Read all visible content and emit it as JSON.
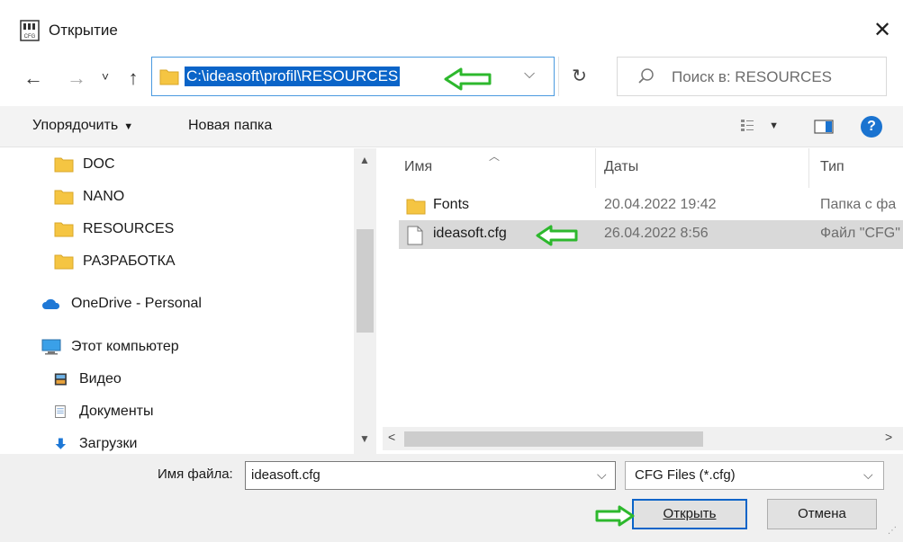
{
  "window": {
    "title": "Открытие",
    "close_label": "✕"
  },
  "nav": {
    "back": "←",
    "forward": "→",
    "recent": "˅",
    "up": "↑",
    "address_path": "C:\\ideasoft\\profil\\RESOURCES",
    "address_dropdown": "⌵",
    "refresh": "↻",
    "search_placeholder": "Поиск в: RESOURCES"
  },
  "toolbar": {
    "organize": "Упорядочить",
    "new_folder": "Новая папка",
    "help": "?"
  },
  "tree": [
    {
      "label": "DOC",
      "icon": "folder-icon"
    },
    {
      "label": "NANO",
      "icon": "folder-icon"
    },
    {
      "label": "RESOURCES",
      "icon": "folder-icon"
    },
    {
      "label": "РАЗРАБОТКА",
      "icon": "folder-icon"
    },
    {
      "label": "OneDrive - Personal",
      "icon": "cloud-icon"
    },
    {
      "label": "Этот компьютер",
      "icon": "computer-icon"
    },
    {
      "label": "Видео",
      "icon": "video-icon"
    },
    {
      "label": "Документы",
      "icon": "document-icon"
    },
    {
      "label": "Загрузки",
      "icon": "download-icon"
    }
  ],
  "columns": {
    "name": "Имя",
    "date": "Даты",
    "type": "Тип"
  },
  "files": [
    {
      "name": "Fonts",
      "date": "20.04.2022 19:42",
      "type": "Папка с фа",
      "icon": "folder-icon",
      "selected": false
    },
    {
      "name": "ideasoft.cfg",
      "date": "26.04.2022 8:56",
      "type": "Файл \"CFG\"",
      "icon": "file-icon",
      "selected": true
    }
  ],
  "bottom": {
    "filename_label": "Имя файла:",
    "filename_value": "ideasoft.cfg",
    "filetype_value": "CFG Files (*.cfg)",
    "open_label": "Открыть",
    "cancel_label": "Отмена"
  },
  "colors": {
    "accent": "#0a64c8",
    "arrow": "#2db82d",
    "folder": "#f5c542"
  }
}
